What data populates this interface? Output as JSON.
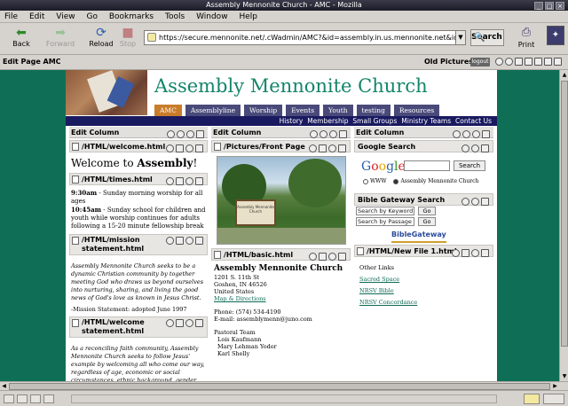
{
  "window": {
    "title": "Assembly Mennonite Church - AMC - Mozilla"
  },
  "menu": [
    "File",
    "Edit",
    "View",
    "Go",
    "Bookmarks",
    "Tools",
    "Window",
    "Help"
  ],
  "nav": {
    "back": "Back",
    "forward": "Forward",
    "reload": "Reload",
    "stop": "Stop",
    "url": "https://secure.mennonite.net/.cWadmin/AMC?&id=assembly.in.us.mennonite.net&id=a",
    "search": "Search",
    "print": "Print"
  },
  "editbar": {
    "label": "Edit Page AMC",
    "old_pictures": "Old Pictures",
    "logout": "logout"
  },
  "site": {
    "title": "Assembly Mennonite Church",
    "tabs": [
      "AMC",
      "Assemblyline",
      "Worship",
      "Events",
      "Youth",
      "testing",
      "Resources"
    ],
    "subnav": [
      "History",
      "Membership",
      "Small Groups",
      "Ministry Teams",
      "Contact Us"
    ]
  },
  "col1": {
    "head": "Edit Column",
    "blk1": "/HTML/welcome.html",
    "welcome_prefix": "Welcome to ",
    "welcome_bold": "Assembly",
    "welcome_suffix": "!",
    "blk2": "/HTML/times.html",
    "time1": "9:30am",
    "time1_text": " - Sunday morning worship for all ages",
    "time2": "10:45am",
    "time2_text": " - Sunday school for children and youth while worship continues for adults following a 15-20 minute fellowship break",
    "blk3_line1": "/HTML/mission",
    "blk3_line2": "statement.html",
    "mission": "Assembly Mennonite Church seeks to be a dynamic Christian community by together meeting God who draws us beyond ourselves into nurturing, sharing, and living the good news of God's love as known in Jesus Christ.",
    "mission_note": "-Mission Statement: adopted June 1997",
    "blk4_line1": "/HTML/welcome",
    "blk4_line2": "statement.html",
    "welcome_stmt": "As a reconciling faith community, Assembly Mennonite Church seeks to follow Jesus' example by welcoming all who come our way, regardless of age, economic or social circumstances, ethnic background, gender,"
  },
  "col2": {
    "head": "Edit Column",
    "blk1": "/Pictures/Front Page",
    "sign_text": "Assembly Mennonite Church",
    "blk2": "/HTML/basic.html",
    "church_name": "Assembly Mennonite Church",
    "addr1": "1201 S. 11th St",
    "addr2": "Goshen, IN 46526",
    "addr3": "United States",
    "map_link": "Map & Directions",
    "phone": "Phone: (574) 534-4190",
    "email": "E-mail: assemblymenn@juno.com",
    "pastoral_team": "Pastoral Team",
    "pastor1": "Lois Kaufmann",
    "pastor2": "Mary Lehman Yoder",
    "pastor3": "Karl Shelly"
  },
  "col3": {
    "head": "Edit Column",
    "google_head": "Google Search",
    "google_btn": "Search",
    "radio_www": "WWW",
    "radio_site": "Assembly Mennonite Church",
    "bg_head": "Bible Gateway Search",
    "bg_keyword": "Search by Keyword",
    "bg_passage": "Search by Passage",
    "bg_go": "Go",
    "bg_logo": "BibleGateway",
    "blk_new": "/HTML/New File 1.html",
    "other_links": "Other Links",
    "link1": "Sacred Space",
    "link2": "NRSV Bible",
    "link3": "NRSV Concordance"
  }
}
